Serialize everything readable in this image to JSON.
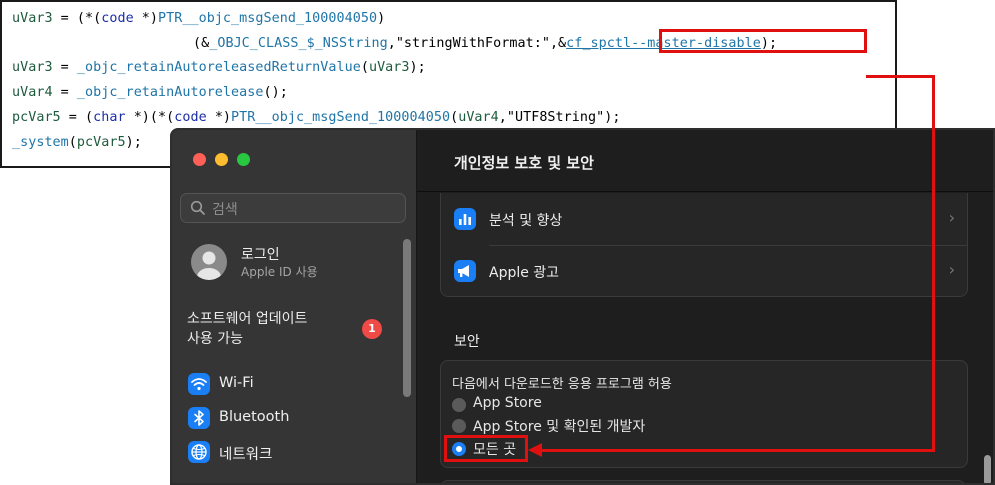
{
  "code": {
    "line1": {
      "lhs": "uVar3",
      "op": " = (*(",
      "kw": "code",
      "star": " *)",
      "fn": "PTR__objc_msgSend_100004050"
    },
    "line2": {
      "open": "(&",
      "cls": "_OBJC_CLASS_$_NSString",
      "str": ",\"stringWithFormat:\",&",
      "cf_pre": "cf_",
      "cf_highlight": "spctl--master-disable",
      "close": ");"
    },
    "line3": {
      "lhs": "uVar3",
      "op": " = ",
      "fn": "_objc_retainAutoreleasedReturnValue",
      "open": "(",
      "arg": "uVar3",
      "close": ");"
    },
    "line4": {
      "lhs": "uVar4",
      "op": " = ",
      "fn": "_objc_retainAutorelease",
      "close": "();"
    },
    "line5": {
      "lhs": "pcVar5",
      "op": " = (",
      "kw1": "char",
      "mid": " *)(*(",
      "kw2": "code",
      "star": " *)",
      "fn": "PTR__objc_msgSend_100004050",
      "open": "(",
      "arg": "uVar4",
      "str": ",\"UTF8String\");"
    },
    "line6": {
      "fn": "_system",
      "open": "(",
      "arg": "pcVar5",
      "close": ");"
    }
  },
  "window": {
    "title": "개인정보 보호 및 보안",
    "traffic_colors": [
      "#fe5f57",
      "#febc2e",
      "#28c840"
    ],
    "search_placeholder": "검색",
    "account": {
      "name": "로그인",
      "sub": "Apple ID 사용"
    },
    "update": {
      "line1": "소프트웨어 업데이트",
      "line2": "사용 가능",
      "badge": "1"
    },
    "sidebar_items": [
      {
        "label": "Wi-Fi",
        "icon": "wifi-icon"
      },
      {
        "label": "Bluetooth",
        "icon": "bluetooth-icon"
      },
      {
        "label": "네트워크",
        "icon": "globe-icon"
      }
    ],
    "rows": [
      {
        "label": "분석 및 향상",
        "icon": "chart-bars-icon"
      },
      {
        "label": "Apple 광고",
        "icon": "megaphone-icon"
      }
    ],
    "security_header": "보안",
    "allow_label": "다음에서 다운로드한 응용 프로그램 허용",
    "options": [
      {
        "label": "App Store",
        "selected": false
      },
      {
        "label": "App Store 및 확인된 개발자",
        "selected": false
      },
      {
        "label": "모든 곳",
        "selected": true
      }
    ]
  },
  "annotation_color": "#e01010",
  "accent_color": "#1a7ef5"
}
